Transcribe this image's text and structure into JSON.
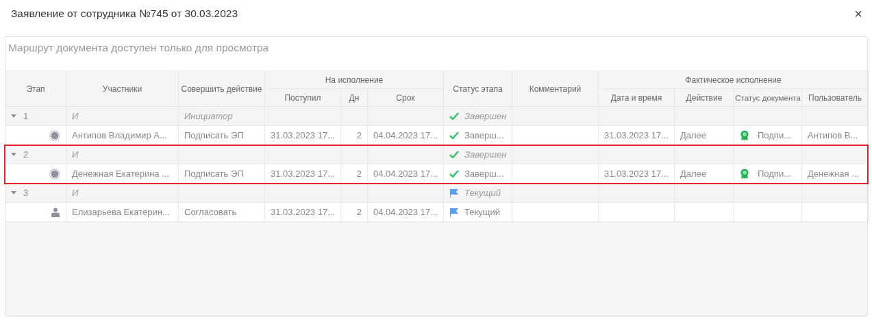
{
  "window": {
    "title": "Заявление от сотрудника №745 от 30.03.2023",
    "close": "×"
  },
  "notice": "Маршрут документа доступен только для просмотра",
  "table": {
    "columns": {
      "stage": "Этап",
      "participants": "Участники",
      "action": "Совершить действие",
      "execution_group": "На исполнение",
      "received": "Поступил",
      "days": "Дн",
      "deadline": "Срок",
      "stage_status": "Статус этапа",
      "comment": "Комментарий",
      "actual_group": "Фактическое исполнение",
      "datetime": "Дата и время",
      "done_action": "Действие",
      "doc_status": "Статус документа",
      "user": "Пользователь"
    },
    "stages": [
      {
        "number": "1",
        "expanded": true,
        "highlighted": false,
        "type": "И",
        "action": "Инициатор",
        "status": {
          "kind": "done",
          "text": "Завершен"
        },
        "children": [
          {
            "kind": "group",
            "name": "Антипов Владимир А...",
            "action": "Подписать ЭП",
            "received": "31.03.2023 17...",
            "days": "2",
            "deadline": "04.04.2023 17...",
            "status": {
              "kind": "done",
              "text": "Заверш..."
            },
            "datetime": "31.03.2023 17...",
            "done_action": "Далее",
            "doc_status": "Подпи...",
            "user": "Антипов В..."
          }
        ]
      },
      {
        "number": "2",
        "expanded": true,
        "highlighted": true,
        "type": "И",
        "status": {
          "kind": "done",
          "text": "Завершен"
        },
        "children": [
          {
            "kind": "group",
            "name": "Денежная Екатерина ...",
            "action": "Подписать ЭП",
            "received": "31.03.2023 17...",
            "days": "2",
            "deadline": "04.04.2023 17...",
            "status": {
              "kind": "done",
              "text": "Заверш..."
            },
            "datetime": "31.03.2023 17...",
            "done_action": "Далее",
            "doc_status": "Подпи...",
            "user": "Денежная ..."
          }
        ]
      },
      {
        "number": "3",
        "expanded": true,
        "highlighted": false,
        "type": "И",
        "status": {
          "kind": "current",
          "text": "Текущий"
        },
        "children": [
          {
            "kind": "user",
            "name": "Елизарьева Екатерин...",
            "action": "Согласовать",
            "received": "31.03.2023 17...",
            "days": "2",
            "deadline": "04.04.2023 17...",
            "status": {
              "kind": "current",
              "text": "Текущий"
            }
          }
        ]
      }
    ]
  }
}
